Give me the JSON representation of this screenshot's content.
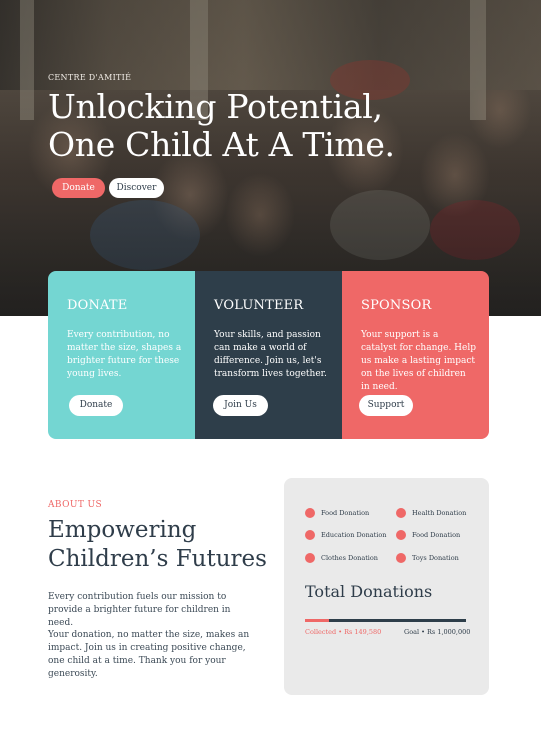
{
  "hero": {
    "eyebrow": "CENTRE D'AMITIÉ",
    "headline_line1": "Unlocking Potential,",
    "headline_line2": "One Child At A Time.",
    "donate_label": "Donate",
    "discover_label": "Discover"
  },
  "cards": [
    {
      "title": "DONATE",
      "text": "Every contribution, no matter the size, shapes a brighter future for these young lives.",
      "button": "Donate",
      "color": "#74d6d2"
    },
    {
      "title": "VOLUNTEER",
      "text": "Your skills, and passion can make a world of difference. Join us, let's transform lives together.",
      "button": "Join Us",
      "color": "#2e3e4a"
    },
    {
      "title": "SPONSOR",
      "text": "Your support is a catalyst for change. Help us make a lasting impact on the lives of children in need.",
      "button": "Support",
      "color": "#ef6867"
    }
  ],
  "about": {
    "label": "ABOUT US",
    "title": "Empowering Children’s Futures",
    "p1": "Every contribution fuels our mission to provide a brighter future for children in need.",
    "p2": "Your donation, no matter the size, makes an impact. Join us in creating positive change, one child at a time. Thank you for your generosity."
  },
  "donations": {
    "legend": [
      "Food Donation",
      "Health Donation",
      "Education Donation",
      "Food Donation",
      "Clothes Donation",
      "Toys Donation"
    ],
    "title": "Total Donations",
    "collected_label": "Collected • Rs 149,580",
    "goal_label": "Goal • Rs 1,000,000",
    "progress_fraction": 0.1496
  },
  "colors": {
    "accent": "#ef6867",
    "teal": "#74d6d2",
    "navy": "#2e3e4a"
  }
}
